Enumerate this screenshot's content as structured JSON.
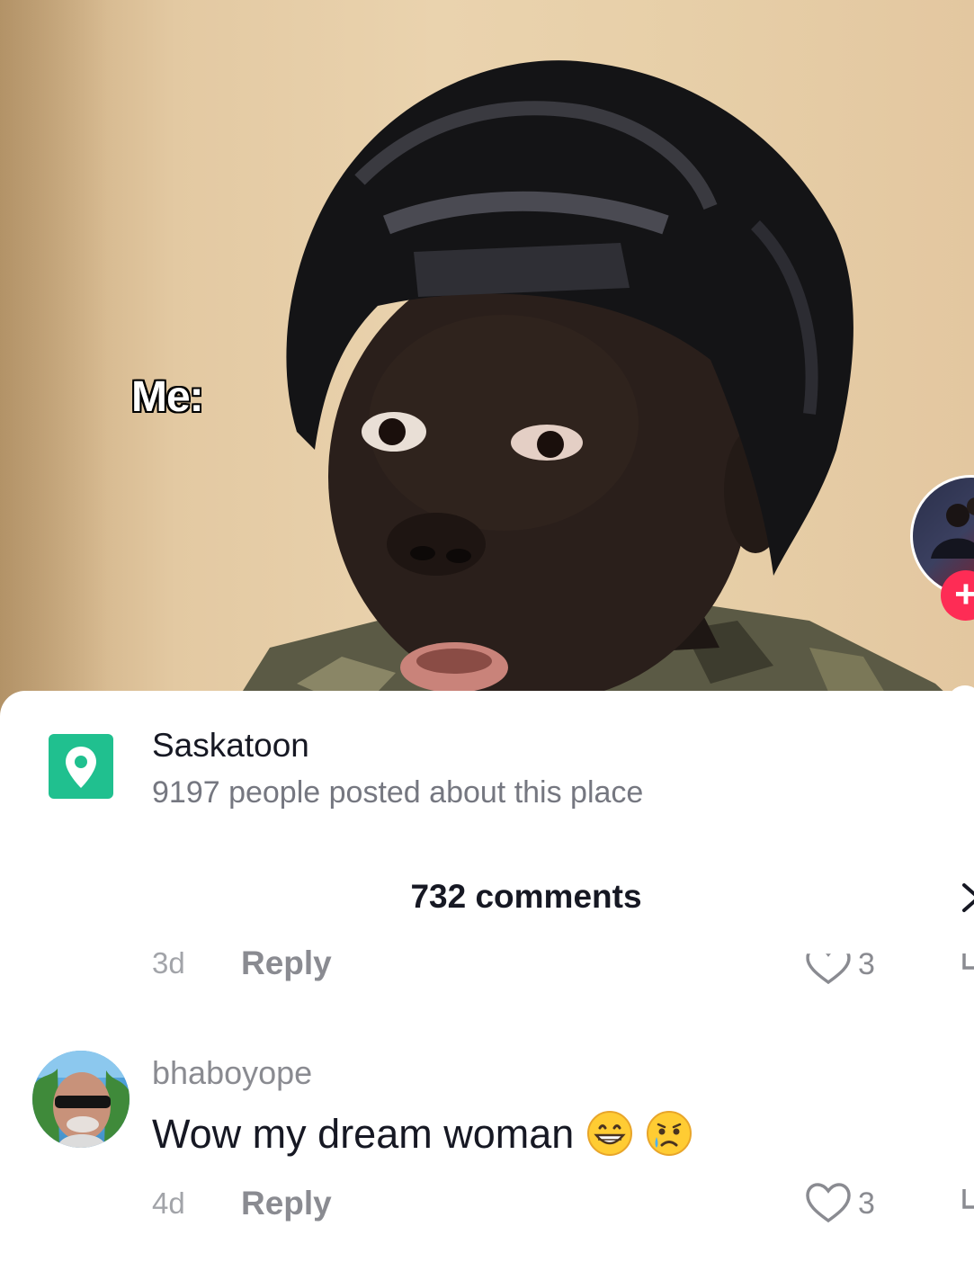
{
  "video": {
    "overlay_text": "Me:",
    "follow_symbol": "+"
  },
  "location": {
    "name": "Saskatoon",
    "subtitle": "9197 people posted about this place",
    "icon": "location-pin-icon",
    "accent": "#20c08f"
  },
  "comments": {
    "count_label": "732 comments",
    "close_icon": "close-icon",
    "items": [
      {
        "time": "3d",
        "reply_label": "Reply",
        "likes": "3"
      },
      {
        "username": "bhaboyope",
        "text": "Wow my dream woman",
        "emojis": [
          "grinning-face-emoji",
          "crying-face-emoji"
        ],
        "time": "4d",
        "reply_label": "Reply",
        "likes": "3"
      }
    ]
  },
  "colors": {
    "follow_accent": "#fe2c55",
    "primary_text": "#161823",
    "secondary_text": "#8a8b91"
  }
}
